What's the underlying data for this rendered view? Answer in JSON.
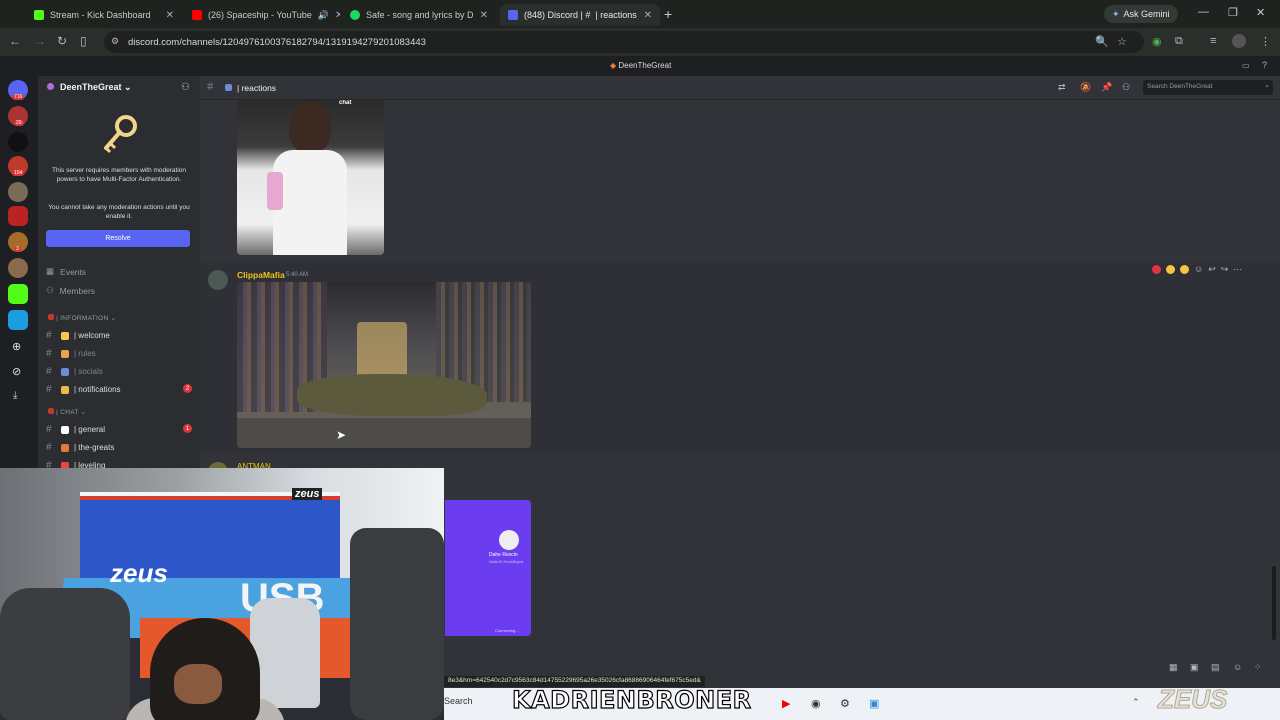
{
  "browser": {
    "tabs": [
      {
        "title": "Stream - Kick Dashboard",
        "favicon_color": "#53fc18"
      },
      {
        "title": "(26) Spaceship - YouTube",
        "favicon_color": "#ff0000"
      },
      {
        "title": "Safe - song and lyrics by Drū C",
        "favicon_color": "#1ed760"
      },
      {
        "title": "(848) Discord | #  | reactions",
        "favicon_color": "#5865f2"
      }
    ],
    "gemini_label": "Ask Gemini",
    "url": "discord.com/channels/1204976100376182794/1319194279201083443"
  },
  "discord": {
    "window_title": "DeenTheGreat",
    "server_name": "DeenTheGreat",
    "mfa_notice": "This server requires members with moderation powers to have Multi-Factor Authentication.",
    "mfa_warning": "You cannot take any moderation actions until you enable it.",
    "resolve_label": "Resolve",
    "nav": {
      "events": "Events",
      "members": "Members"
    },
    "categories": {
      "information": "| INFORMATION",
      "chat": "| CHAT"
    },
    "channels": [
      {
        "name": "| welcome",
        "emoji_color": "#f7c948",
        "muted": false
      },
      {
        "name": "| rules",
        "emoji_color": "#e8a44c",
        "muted": true
      },
      {
        "name": "| socials",
        "emoji_color": "#6b8cd6",
        "muted": true
      },
      {
        "name": "| notifications",
        "emoji_color": "#f2b84b",
        "muted": false,
        "badge": "2"
      },
      {
        "name": "| general",
        "emoji_color": "#ffffff",
        "muted": false,
        "badge": "1"
      },
      {
        "name": "| the-greats",
        "emoji_color": "#e07b39",
        "muted": false
      },
      {
        "name": "| leveling",
        "emoji_color": "#e44",
        "muted": false
      }
    ],
    "rail_badges": [
      "716",
      "29",
      "154",
      "3"
    ],
    "channel_header": "| reactions",
    "search_placeholder": "Search DeenTheGreat",
    "image_caption_chat": "chat",
    "messages": [
      {
        "author": "ClippaMafia",
        "time": "5:40 AM"
      },
      {
        "author": "ANTMAN",
        "time": ""
      }
    ],
    "embed": {
      "name": "Dahe Rescin",
      "subtitle": "Mafia Of ZeuskBegins",
      "footer": "Connecting..."
    }
  },
  "status_url": "8e3&hm=642540c2d7c9563c84d14755229695a26e35026cfa86886906464fef675c5ed&",
  "taskbar": {
    "search_label": "Search",
    "overlay_name": "KADRIENBRONER"
  },
  "webcam": {
    "wordmark_large": "zeus",
    "wordmark_small": "zeus",
    "apron_text": "USB"
  },
  "watermark": "ZEUS"
}
